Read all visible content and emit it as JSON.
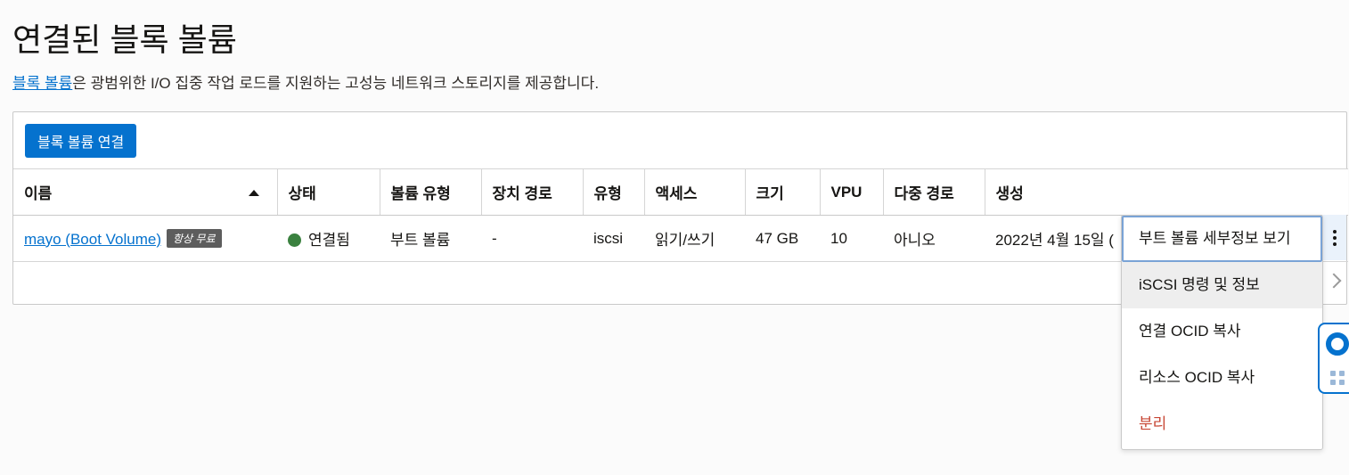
{
  "page": {
    "title": "연결된 블록 볼륨",
    "description_link": "블록 볼륨",
    "description_rest": "은 광범위한 I/O 집중 작업 로드를 지원하는 고성능 네트워크 스토리지를 제공합니다."
  },
  "toolbar": {
    "attach_button": "블록 볼륨 연결"
  },
  "table": {
    "columns": [
      "이름",
      "상태",
      "볼륨 유형",
      "장치 경로",
      "유형",
      "액세스",
      "크기",
      "VPU",
      "다중 경로",
      "생성"
    ],
    "sort": {
      "column": "이름",
      "direction": "ascending"
    },
    "rows": [
      {
        "name": "mayo (Boot Volume)",
        "badge": "항상 무료",
        "status": "연결됨",
        "volume_type": "부트 볼륨",
        "device_path": "-",
        "type": "iscsi",
        "access": "읽기/쓰기",
        "size": "47 GB",
        "vpu": "10",
        "multipath": "아니오",
        "created": "2022년 4월 15일 (",
        "status_color": "#3a813f"
      }
    ]
  },
  "action_menu": {
    "items": [
      {
        "label": "부트 볼륨 세부정보 보기"
      },
      {
        "label": "iSCSI 명령 및 정보"
      },
      {
        "label": "연결 OCID 복사"
      },
      {
        "label": "리소스 OCID 복사"
      },
      {
        "label": "분리"
      }
    ]
  },
  "icons": {
    "sort": "sort-ascending-icon",
    "row_actions": "kebab-menu-icon",
    "pagination": "chevron-right-icon",
    "help": "lifebuoy-icon",
    "drag": "grip-icon"
  },
  "colors": {
    "accent": "#0572ce",
    "status_attached": "#3a813f",
    "danger": "#c74634",
    "badge": "#5d5d5d"
  }
}
